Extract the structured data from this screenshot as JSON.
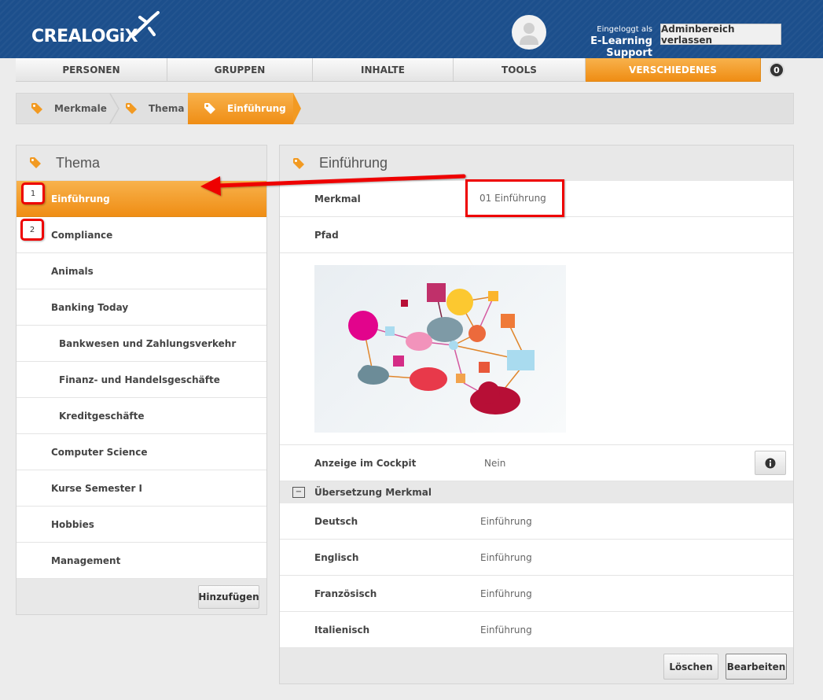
{
  "brand": {
    "logo_text": "CREALOGiX"
  },
  "user": {
    "logged_in_label": "Eingeloggt als",
    "name": "E-Learning Support"
  },
  "admin_button": "Adminbereich verlassen",
  "tabs": [
    {
      "label": "PERSONEN",
      "active": false
    },
    {
      "label": "GRUPPEN",
      "active": false
    },
    {
      "label": "INHALTE",
      "active": false
    },
    {
      "label": "TOOLS",
      "active": false
    },
    {
      "label": "VERSCHIEDENES",
      "active": true
    }
  ],
  "notification_count": "0",
  "breadcrumb": [
    "Merkmale",
    "Thema",
    "Einführung"
  ],
  "left_panel": {
    "title": "Thema",
    "items": [
      {
        "label": "Einführung",
        "level": 1,
        "active": true
      },
      {
        "label": "Compliance",
        "level": 1,
        "active": false
      },
      {
        "label": "Animals",
        "level": 1,
        "active": false
      },
      {
        "label": "Banking Today",
        "level": 1,
        "active": false
      },
      {
        "label": "Bankwesen und Zahlungsverkehr",
        "level": 2,
        "active": false
      },
      {
        "label": "Finanz- und Handelsgeschäfte",
        "level": 2,
        "active": false
      },
      {
        "label": "Kreditgeschäfte",
        "level": 2,
        "active": false
      },
      {
        "label": "Computer Science",
        "level": 1,
        "active": false
      },
      {
        "label": "Kurse Semester I",
        "level": 1,
        "active": false
      },
      {
        "label": "Hobbies",
        "level": 1,
        "active": false
      },
      {
        "label": "Management",
        "level": 1,
        "active": false
      }
    ],
    "add_button": "Hinzufügen"
  },
  "detail": {
    "title": "Einführung",
    "merkmal_label": "Merkmal",
    "merkmal_value": "01 Einführung",
    "pfad_label": "Pfad",
    "cockpit_label": "Anzeige im Cockpit",
    "cockpit_value": "Nein",
    "translation_section": "Übersetzung Merkmal",
    "translations": [
      {
        "lang": "Deutsch",
        "value": "Einführung"
      },
      {
        "lang": "Englisch",
        "value": "Einführung"
      },
      {
        "lang": "Französisch",
        "value": "Einführung"
      },
      {
        "lang": "Italienisch",
        "value": "Einführung"
      }
    ],
    "delete_button": "Löschen",
    "edit_button": "Bearbeiten"
  },
  "annotations": [
    "1",
    "2"
  ],
  "colors": {
    "header_blue": "#1c4f8c",
    "accent_orange": "#f29a22",
    "annotation_red": "#e00000"
  }
}
